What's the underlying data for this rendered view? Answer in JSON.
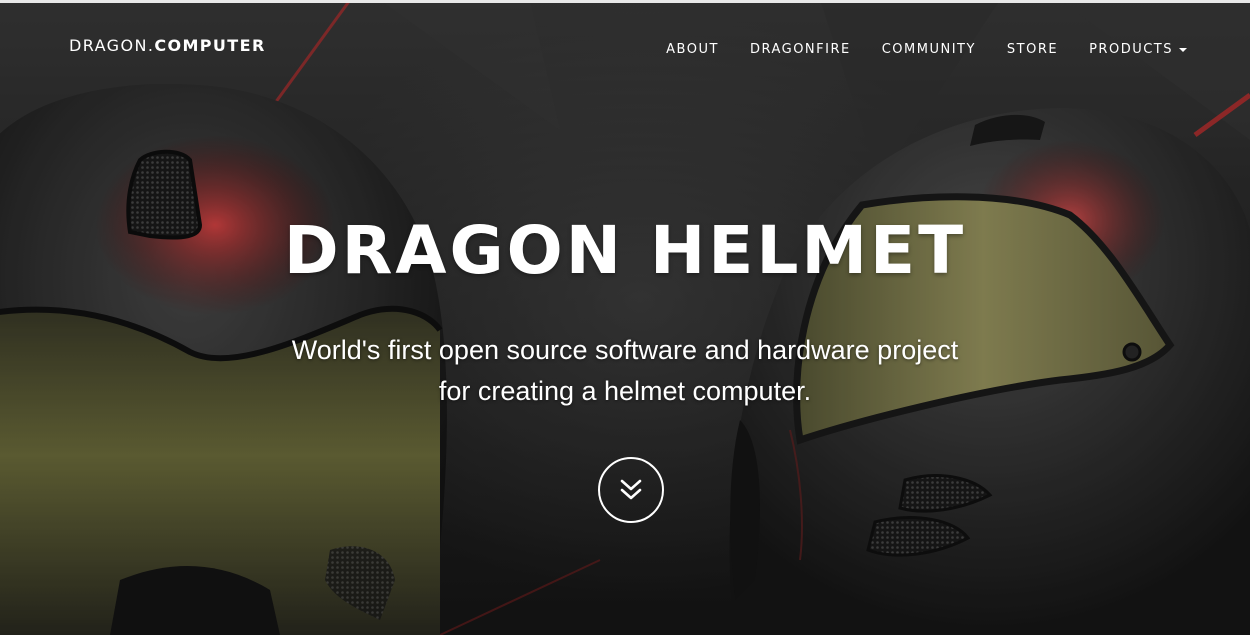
{
  "brand": {
    "part1": "DRAGON.",
    "part2": "COMPUTER"
  },
  "nav": {
    "items": [
      {
        "label": "ABOUT"
      },
      {
        "label": "DRAGONFIRE"
      },
      {
        "label": "COMMUNITY"
      },
      {
        "label": "STORE"
      },
      {
        "label": "PRODUCTS"
      }
    ]
  },
  "hero": {
    "title": "DRAGON HELMET",
    "subtitle_line1": "World's first open source software and hardware project",
    "subtitle_line2": "for creating a helmet computer.",
    "scroll_icon": "double-chevron-down-icon"
  },
  "colors": {
    "text": "#ffffff",
    "background": "#262626",
    "accent_red": "#d23a3a",
    "visor": "#8a8a4a"
  }
}
